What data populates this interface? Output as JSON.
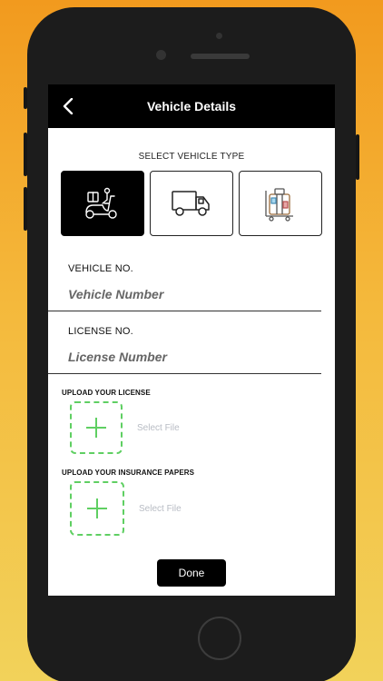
{
  "navbar": {
    "title": "Vehicle Details",
    "back_icon": "chevron-left-icon"
  },
  "vehicle_type": {
    "label": "SELECT VEHICLE TYPE",
    "options": [
      {
        "icon": "scooter-icon",
        "selected": true
      },
      {
        "icon": "truck-icon",
        "selected": false
      },
      {
        "icon": "luggage-cart-icon",
        "selected": false
      }
    ]
  },
  "vehicle_no": {
    "label": "VEHICLE NO.",
    "placeholder": "Vehicle Number",
    "value": ""
  },
  "license_no": {
    "label": "LICENSE NO.",
    "placeholder": "License Number",
    "value": ""
  },
  "upload_license": {
    "title": "UPLOAD YOUR LICENSE",
    "select_text": "Select File",
    "icon": "plus-icon"
  },
  "upload_insurance": {
    "title": "UPLOAD YOUR INSURANCE PAPERS",
    "select_text": "Select File",
    "icon": "plus-icon"
  },
  "done_label": "Done",
  "colors": {
    "accent_green": "#5fcf62",
    "navbar": "#000000",
    "background_top": "#f29a1e",
    "background_bottom": "#f2d25a"
  }
}
